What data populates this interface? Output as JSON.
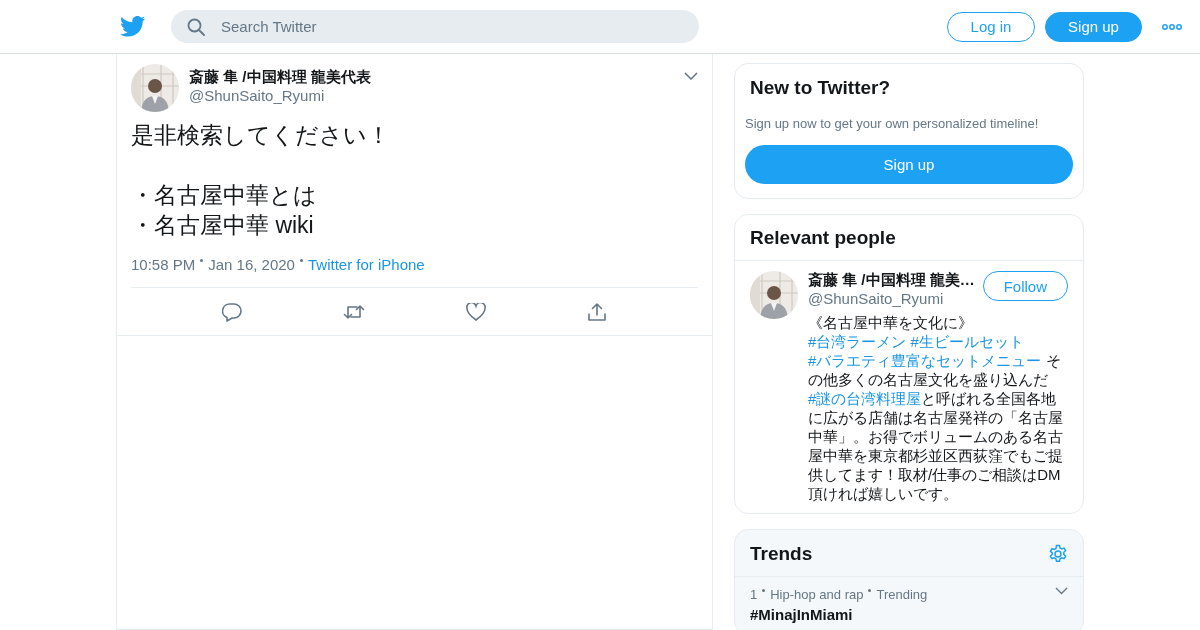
{
  "header": {
    "search": {
      "placeholder": "Search Twitter"
    },
    "buttons": [
      {
        "label": "Log in",
        "kind": "outline"
      },
      {
        "label": "Sign up",
        "kind": "filled"
      }
    ]
  },
  "tweet": {
    "author": {
      "name": "斎藤 隼 /中国料理 龍美代表",
      "handle": "@ShunSaito_Ryumi"
    },
    "paragraphs": [
      [
        "是非検索してください！"
      ],
      [
        "・名古屋中華とは",
        "・名古屋中華 wiki"
      ]
    ],
    "meta": [
      {
        "text": "10:58 PM",
        "kind": "text"
      },
      {
        "text": "Jan 16, 2020",
        "kind": "text"
      },
      {
        "text": "Twitter for iPhone",
        "kind": "link"
      }
    ]
  },
  "signup_card": {
    "title": "New to Twitter?",
    "text": "Sign up now to get your own personalized timeline!",
    "button": "Sign up"
  },
  "people_card": {
    "title": "Relevant people",
    "person": {
      "name": "斎藤 隼 /中国料理 龍美…",
      "handle": "@ShunSaito_Ryumi",
      "follow": "Follow",
      "bio": [
        {
          "text": "《名古屋中華を文化に》",
          "kind": "text"
        },
        {
          "text": "#台湾ラーメン",
          "kind": "hashtag"
        },
        {
          "text": "#生ビールセット",
          "kind": "hashtag"
        },
        {
          "text": "#バラエティ豊富なセットメニュー",
          "kind": "hashtag"
        },
        {
          "text": " その他多くの名古屋文化を盛り込んだ ",
          "kind": "text"
        },
        {
          "text": "#謎の台湾料理屋",
          "kind": "hashtag"
        },
        {
          "text": "と呼ばれる全国各地に広がる店舗は名古屋発祥の「名古屋中華」。お得でボリュームのある名古屋中華を東京都杉並区西荻窪でもご提供してます！取材/仕事のご相談はDM頂ければ嬉しいです。",
          "kind": "text"
        }
      ]
    }
  },
  "trends_card": {
    "title": "Trends",
    "items": [
      {
        "meta": [
          "1",
          "Hip-hop and rap",
          "Trending"
        ],
        "name": "#MinajInMiami"
      }
    ]
  }
}
